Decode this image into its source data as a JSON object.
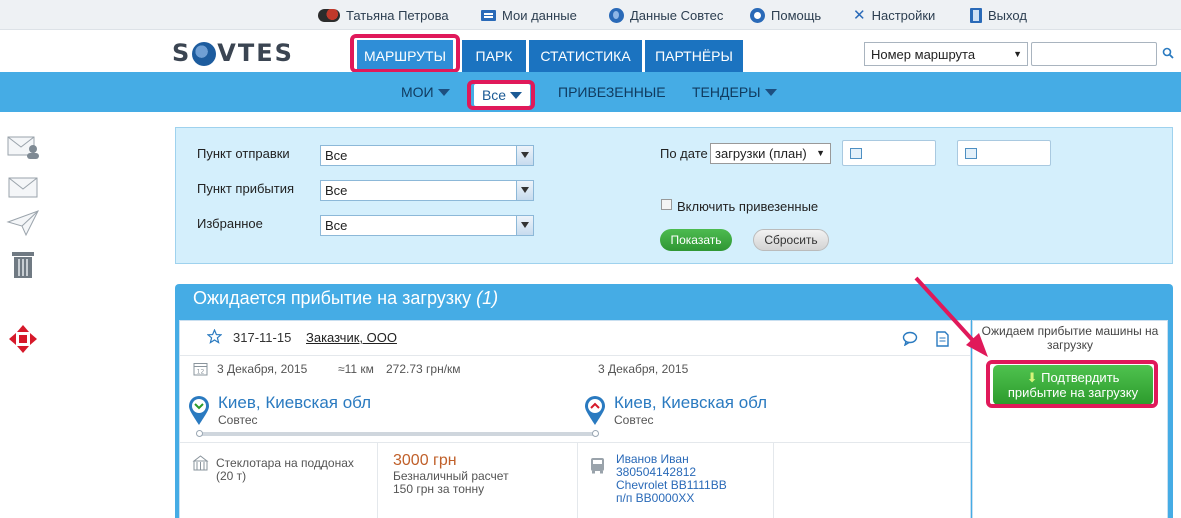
{
  "topbar": {
    "user_name": "Татьяна Петрова",
    "my_data": "Мои данные",
    "sovtes_data": "Данные Совтес",
    "help": "Помощь",
    "settings": "Настройки",
    "logout": "Выход"
  },
  "header": {
    "logo_left": "S",
    "logo_right": "VTES",
    "tabs": [
      {
        "label": "Маршруты",
        "active": true
      },
      {
        "label": "Парк"
      },
      {
        "label": "Статистика"
      },
      {
        "label": "Партнёры"
      }
    ],
    "route_select_value": "Номер маршрута",
    "search_value": ""
  },
  "subnav": {
    "items": [
      {
        "label": "Мои"
      },
      {
        "label": "Все"
      },
      {
        "label": "Привезенные"
      },
      {
        "label": "Тендеры"
      }
    ]
  },
  "left_icons": [
    "contact-mail-icon",
    "mail-icon",
    "send-icon",
    "trash-icon",
    "nova-poshta-icon"
  ],
  "filter": {
    "departure_label": "Пункт отправки",
    "departure_value": "Все",
    "arrival_label": "Пункт прибытия",
    "arrival_value": "Все",
    "favorites_label": "Избранное",
    "favorites_value": "Все",
    "date_label": "По дате",
    "date_type_value": "загрузки (план)",
    "include_delivered_label": "Включить привезенные",
    "show_button": "Показать",
    "reset_button": "Сбросить"
  },
  "results": {
    "title": "Ожидается прибытие на загрузку",
    "count": "(1)",
    "route": {
      "id": "317-11-15",
      "customer": "Заказчик, ООО",
      "load_date": "3 Декабря, 2015",
      "distance": "≈11 км",
      "rate": "272.73 грн/км",
      "unload_date": "3 Декабря, 2015",
      "from_city": "Киев, Киевская обл",
      "from_company": "Совтес",
      "to_city": "Киев, Киевская обл",
      "to_company": "Совтес",
      "cargo": "Стеклотара на поддонах",
      "cargo_weight": "(20 т)",
      "price": "3000 грн",
      "payment_type": "Безналичный расчет",
      "price_per_ton": "150 грн за тонну",
      "driver_name": "Иванов Иван",
      "driver_phone": "380504142812",
      "vehicle": "Chevrolet BB1111BB",
      "trailer": "п/п BB0000XX"
    },
    "status_text": "Ожидаем прибытие машины на загрузку",
    "confirm_button_line1": "Подтвердить",
    "confirm_button_line2": "прибытие на загрузку"
  },
  "colors": {
    "accent_blue": "#45ace5",
    "tab_blue": "#1b73c0",
    "highlight_pink": "#e0195a",
    "confirm_green": "#3aa83a",
    "price_orange": "#c0602a"
  }
}
